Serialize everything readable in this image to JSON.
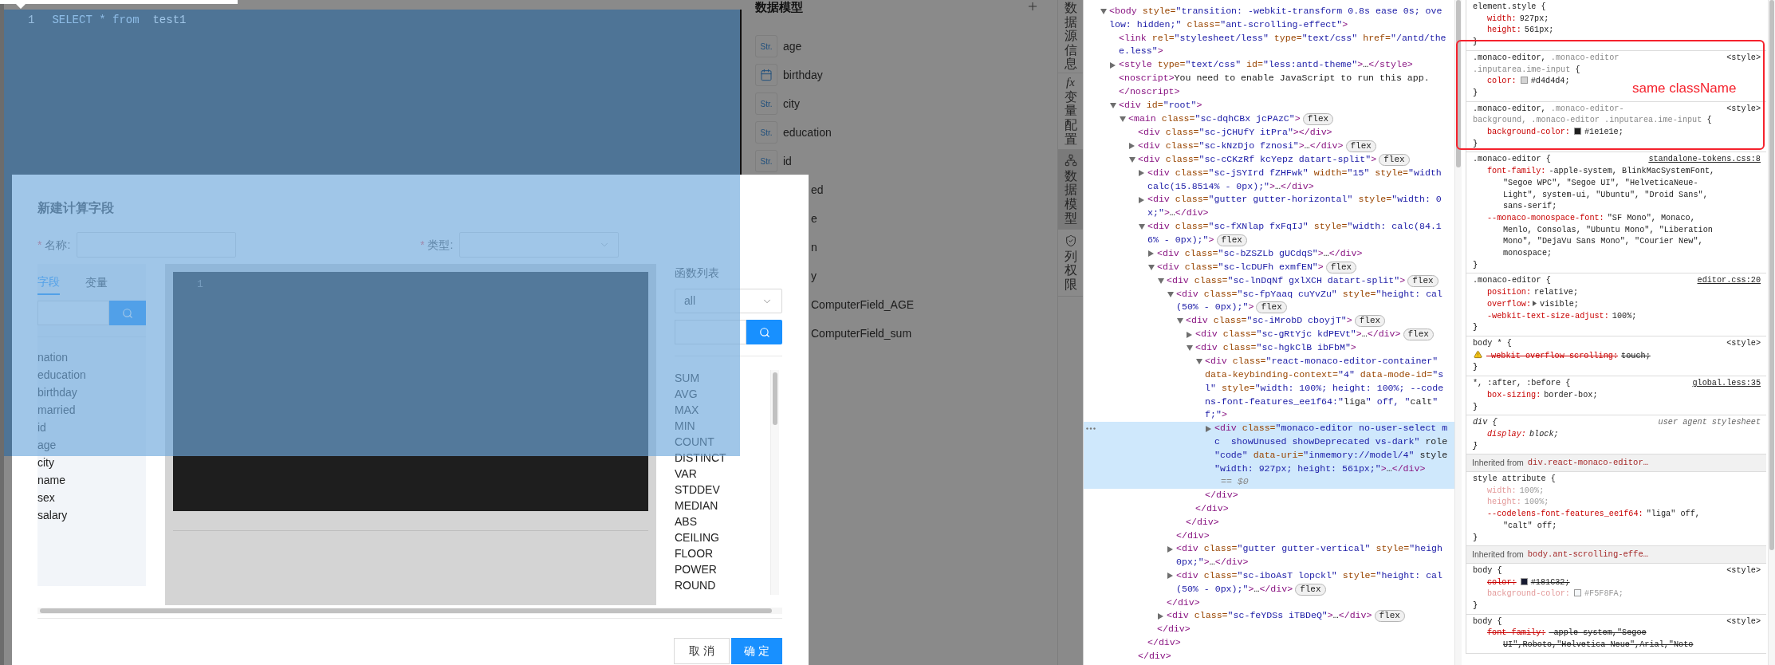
{
  "editor": {
    "line_number": "1",
    "tokens": [
      {
        "text": "SELECT",
        "kind": "keyword"
      },
      {
        "text": " * ",
        "kind": "operator"
      },
      {
        "text": "from",
        "kind": "keyword"
      },
      {
        "text": "  test1",
        "kind": "identifier"
      }
    ]
  },
  "data_model": {
    "title": "数据模型",
    "fields": [
      {
        "name": "age",
        "kind": "string",
        "badge": "Str."
      },
      {
        "name": "birthday",
        "kind": "date"
      },
      {
        "name": "city",
        "kind": "string",
        "badge": "Str."
      },
      {
        "name": "education",
        "kind": "string",
        "badge": "Str."
      },
      {
        "name": "id",
        "kind": "string",
        "badge": "Str."
      },
      {
        "name": "ed",
        "kind": "covered"
      },
      {
        "name": "e",
        "kind": "covered"
      },
      {
        "name": "n",
        "kind": "covered"
      },
      {
        "name": "y",
        "kind": "covered"
      },
      {
        "name": "ComputerField_AGE",
        "kind": "covered"
      },
      {
        "name": "ComputerField_sum",
        "kind": "covered"
      }
    ]
  },
  "side_tabs": [
    {
      "label": "数据源信息",
      "selected": false,
      "kind": "none"
    },
    {
      "label": "变量配置",
      "selected": false,
      "kind": "fx",
      "glyph": "fx"
    },
    {
      "label": "数据模型",
      "selected": true,
      "kind": "model"
    },
    {
      "label": "列权限",
      "selected": false,
      "kind": "shield"
    }
  ],
  "modal": {
    "title": "新建计算字段",
    "name_field": {
      "required_mark": "*",
      "label": "名称:"
    },
    "type_field": {
      "required_mark": "*",
      "label": "类型:"
    },
    "tabs": [
      {
        "label": "字段",
        "selected": true
      },
      {
        "label": "变量",
        "selected": false
      }
    ],
    "fields": [
      "nation",
      "education",
      "birthday",
      "married",
      "id",
      "age",
      "city",
      "name",
      "sex",
      "salary"
    ],
    "editor": {
      "line_number": "1"
    },
    "functions": {
      "title": "函数列表",
      "category": "all",
      "items": [
        "SUM",
        "AVG",
        "MAX",
        "MIN",
        "COUNT",
        "DISTINCT",
        "VAR",
        "STDDEV",
        "MEDIAN",
        "ABS",
        "CEILING",
        "FLOOR",
        "POWER",
        "ROUND"
      ]
    },
    "buttons": [
      {
        "label": "取 消",
        "kind": "default"
      },
      {
        "label": "确 定",
        "kind": "primary"
      }
    ]
  },
  "elements": {
    "nodes": [
      {
        "lines": [
          "<body style=\"transition: -webkit-transform 0.8s ease 0s; ove",
          "low: hidden;\" class=\"ant-scrolling-effect\">"
        ],
        "kind": "open",
        "selected": false,
        "children": [
          {
            "lines": [
              "<link rel=\"stylesheet/less\" type=\"text/css\" href=\"/antd/the",
              "e.less\">"
            ],
            "kind": "leaf",
            "selected": false
          },
          {
            "lines": [
              "<style type=\"text/css\" id=\"less:antd-theme\">…</style>"
            ],
            "kind": "closed",
            "selected": false
          },
          {
            "lines": [
              "<noscript>You need to enable JavaScript to run this app.",
              "</noscript>"
            ],
            "kind": "leaf",
            "selected": false
          },
          {
            "lines": [
              "<div id=\"root\">"
            ],
            "kind": "open",
            "selected": false,
            "children": [
              {
                "lines": [
                  "<main class=\"sc-dqhCBx jcPAzC\">"
                ],
                "kind": "open",
                "selected": false,
                "badge": "flex",
                "children": [
                  {
                    "lines": [
                      "<div class=\"sc-jCHUfY itPra\"></div>"
                    ],
                    "kind": "leaf",
                    "selected": false
                  },
                  {
                    "lines": [
                      "<div class=\"sc-kNzDjo fznosi\">…</div>"
                    ],
                    "kind": "closed",
                    "selected": false,
                    "badge": "flex"
                  },
                  {
                    "lines": [
                      "<div class=\"sc-cCKzRf kcYepz datart-split\">"
                    ],
                    "kind": "open",
                    "selected": false,
                    "badge": "flex",
                    "children": [
                      {
                        "lines": [
                          "<div class=\"sc-jSYIrd fZHFwk\" width=\"15\" style=\"width",
                          "calc(15.8514% - 0px);\">…</div>"
                        ],
                        "kind": "closed",
                        "selected": false
                      },
                      {
                        "lines": [
                          "<div class=\"gutter gutter-horizontal\" style=\"width: 0",
                          "x;\">…</div>"
                        ],
                        "kind": "closed",
                        "selected": false
                      },
                      {
                        "lines": [
                          "<div class=\"sc-fXNlap fxFqIJ\" style=\"width: calc(84.1",
                          "6% - 0px);\">"
                        ],
                        "kind": "open",
                        "selected": false,
                        "badge": "flex",
                        "children": [
                          {
                            "lines": [
                              "<div class=\"sc-bZSZLb gUCdqS\">…</div>"
                            ],
                            "kind": "closed",
                            "selected": false
                          },
                          {
                            "lines": [
                              "<div class=\"sc-lcDUFh exmfEN\">"
                            ],
                            "kind": "open",
                            "selected": false,
                            "badge": "flex",
                            "children": [
                              {
                                "lines": [
                                  "<div class=\"sc-lnDqNf gxlXCH datart-split\">"
                                ],
                                "kind": "open",
                                "selected": false,
                                "badge": "flex",
                                "children": [
                                  {
                                    "lines": [
                                      "<div class=\"sc-fpYaaq cuYvZu\" style=\"height: cal",
                                      "(50% - 0px);\">"
                                    ],
                                    "kind": "open",
                                    "selected": false,
                                    "badge": "flex",
                                    "children": [
                                      {
                                        "lines": [
                                          "<div class=\"sc-iMrobD cboyjT\">"
                                        ],
                                        "kind": "open",
                                        "selected": false,
                                        "badge": "flex",
                                        "children": [
                                          {
                                            "lines": [
                                              "<div class=\"sc-gRtYjc kdPEVt\">…</div>"
                                            ],
                                            "kind": "closed",
                                            "selected": false,
                                            "badge": "flex"
                                          },
                                          {
                                            "lines": [
                                              "<div class=\"sc-hgkClB ibFbM\">"
                                            ],
                                            "kind": "open",
                                            "selected": false,
                                            "children": [
                                              {
                                                "lines": [
                                                  "<div class=\"react-monaco-editor-container\"",
                                                  "data-keybinding-context=\"4\" data-mode-id=\"s",
                                                  "l\" style=\"width: 100%; height: 100%; --code",
                                                  "ns-font-features_ee1f64:\"liga\" off, \"calt\"",
                                                  "f;\">"
                                                ],
                                                "kind": "open",
                                                "selected": false,
                                                "children": [
                                                  {
                                                    "lines": [
                                                      "<div class=\"monaco-editor no-user-select m",
                                                      "c  showUnused showDeprecated vs-dark\" role",
                                                      "\"code\" data-uri=\"inmemory://model/4\" style",
                                                      "\"width: 927px; height: 561px;\">…</div>"
                                                    ],
                                                    "kind": "closed",
                                                    "selected": true,
                                                    "suffix": "== $0"
                                                  }
                                                ],
                                                "close": "</div>"
                                              }
                                            ],
                                            "close": "</div>"
                                          }
                                        ],
                                        "close": "</div>"
                                      }
                                    ],
                                    "close": "</div>"
                                  },
                                  {
                                    "lines": [
                                      "<div class=\"gutter gutter-vertical\" style=\"heigh",
                                      "0px;\">…</div>"
                                    ],
                                    "kind": "closed",
                                    "selected": false
                                  },
                                  {
                                    "lines": [
                                      "<div class=\"sc-iboAsT lopckl\" style=\"height: cal",
                                      "(50% - 0px);\">…</div>"
                                    ],
                                    "kind": "closed",
                                    "selected": false,
                                    "badge": "flex"
                                  }
                                ],
                                "close": "</div>"
                              },
                              {
                                "lines": [
                                  "<div class=\"sc-feYDSs iTBDeQ\">…</div>"
                                ],
                                "kind": "closed",
                                "selected": false,
                                "badge": "flex"
                              }
                            ],
                            "close": "</div>"
                          }
                        ],
                        "close": "</div>"
                      }
                    ],
                    "close": "</div>"
                  }
                ]
              }
            ]
          }
        ]
      }
    ]
  },
  "styles": {
    "rules": [
      {
        "kind": "rule",
        "selector": [
          {
            "text": "element.style {",
            "matched": true
          }
        ],
        "decls": [
          {
            "name": "width:",
            "value": "927px;",
            "kind": "plain",
            "struck": false,
            "inactive": false
          },
          {
            "name": "height:",
            "value": "561px;",
            "kind": "plain",
            "struck": false,
            "inactive": false
          }
        ],
        "close": "}"
      },
      {
        "kind": "rule",
        "source": {
          "text": "<style>",
          "kind": "plain"
        },
        "selector": [
          {
            "text": ".monaco-editor, ",
            "matched": true
          },
          {
            "text": ".monaco-editor\n.inputarea.ime-input",
            "matched": false
          },
          {
            "text": " {",
            "matched": true
          }
        ],
        "decls": [
          {
            "name": "color:",
            "value": "#d4d4d4;",
            "kind": "color",
            "color": "#d4d4d4",
            "struck": false,
            "inactive": false
          }
        ],
        "close": "}"
      },
      {
        "kind": "rule",
        "source": {
          "text": "<style>",
          "kind": "plain"
        },
        "selector": [
          {
            "text": ".monaco-editor, ",
            "matched": true
          },
          {
            "text": ".monaco-editor-\nbackground, .monaco-editor .inputarea.ime-input",
            "matched": false
          },
          {
            "text": " {",
            "matched": true
          }
        ],
        "decls": [
          {
            "name": "background-color:",
            "value": "#1e1e1e;",
            "kind": "color",
            "color": "#1e1e1e",
            "struck": false,
            "inactive": false
          }
        ],
        "close": "}"
      },
      {
        "kind": "rule",
        "source": {
          "text": "standalone-tokens.css:8",
          "kind": "link"
        },
        "selector": [
          {
            "text": ".monaco-editor {",
            "matched": true
          }
        ],
        "decls": [
          {
            "name": "font-family:",
            "value": "-apple-system, BlinkMacSystemFont,\n\"Segoe WPC\", \"Segoe UI\", \"HelveticaNeue-\nLight\", system-ui, \"Ubuntu\", \"Droid Sans\",\nsans-serif;",
            "kind": "plain",
            "struck": false,
            "inactive": false
          },
          {
            "name": "--monaco-monospace-font:",
            "value": "\"SF Mono\", Monaco,\nMenlo, Consolas, \"Ubuntu Mono\", \"Liberation\nMono\", \"DejaVu Sans Mono\", \"Courier New\",\nmonospace;",
            "kind": "plain",
            "struck": false,
            "inactive": false
          }
        ],
        "close": "}"
      },
      {
        "kind": "rule",
        "source": {
          "text": "editor.css:20",
          "kind": "link"
        },
        "selector": [
          {
            "text": ".monaco-editor {",
            "matched": true
          }
        ],
        "decls": [
          {
            "name": "position:",
            "value": "relative;",
            "kind": "plain",
            "struck": false,
            "inactive": false
          },
          {
            "name": "overflow:",
            "value": "visible;",
            "kind": "shorthand",
            "struck": false,
            "inactive": false
          },
          {
            "name": "-webkit-text-size-adjust:",
            "value": "100%;",
            "kind": "plain",
            "struck": false,
            "inactive": false
          }
        ],
        "close": "}"
      },
      {
        "kind": "rule",
        "source": {
          "text": "<style>",
          "kind": "plain"
        },
        "selector": [
          {
            "text": "body * {",
            "matched": true
          }
        ],
        "decls": [
          {
            "name": "-webkit-overflow-scrolling:",
            "value": "touch;",
            "kind": "warning",
            "struck": true,
            "inactive": false
          }
        ],
        "close": "}"
      },
      {
        "kind": "rule",
        "source": {
          "text": "global.less:35",
          "kind": "link"
        },
        "selector": [
          {
            "text": "*, :after, :before {",
            "matched": true
          }
        ],
        "decls": [
          {
            "name": "box-sizing:",
            "value": "border-box;",
            "kind": "plain",
            "struck": false,
            "inactive": false
          }
        ],
        "close": "}"
      },
      {
        "kind": "rule",
        "source": {
          "text": "user agent stylesheet",
          "kind": "agent"
        },
        "selector": [
          {
            "text": "div {",
            "matched": true
          }
        ],
        "decls": [
          {
            "name": "display:",
            "value": "block;",
            "kind": "plain",
            "struck": false,
            "inactive": false
          }
        ],
        "close": "}"
      },
      {
        "kind": "inherited",
        "label": "Inherited from",
        "target": "div.react-monaco-editor…"
      },
      {
        "kind": "rule",
        "selector": [
          {
            "text": "style attribute {",
            "matched": true
          }
        ],
        "decls": [
          {
            "name": "width:",
            "value": "100%;",
            "kind": "plain",
            "struck": false,
            "inactive": true
          },
          {
            "name": "height:",
            "value": "100%;",
            "kind": "plain",
            "struck": false,
            "inactive": true
          },
          {
            "name": "--codelens-font-features_ee1f64:",
            "value": "\"liga\" off,\n\"calt\" off;",
            "kind": "plain",
            "struck": false,
            "inactive": false
          }
        ],
        "close": "}"
      },
      {
        "kind": "inherited",
        "label": "Inherited from",
        "target": "body.ant-scrolling-effe…"
      },
      {
        "kind": "rule",
        "source": {
          "text": "<style>",
          "kind": "plain"
        },
        "selector": [
          {
            "text": "body {",
            "matched": true
          }
        ],
        "decls": [
          {
            "name": "color:",
            "value": "#181C32;",
            "kind": "color",
            "color": "#181c32",
            "struck": true,
            "inactive": false
          },
          {
            "name": "background-color:",
            "value": "#F5F8FA;",
            "kind": "color",
            "color": "#f5f8fa",
            "struck": false,
            "inactive": true
          }
        ],
        "close": "}"
      },
      {
        "kind": "rule",
        "source": {
          "text": "<style>",
          "kind": "plain"
        },
        "selector": [
          {
            "text": "body {",
            "matched": true
          }
        ],
        "decls": [
          {
            "name": "font-family:",
            "value": "-apple-system,\"Segoe\nUI\",Roboto,\"Helvetica Neue\",Arial,\"Noto",
            "kind": "plain",
            "struck": true,
            "inactive": false
          }
        ]
      }
    ]
  },
  "annotation": {
    "label": "same className"
  }
}
